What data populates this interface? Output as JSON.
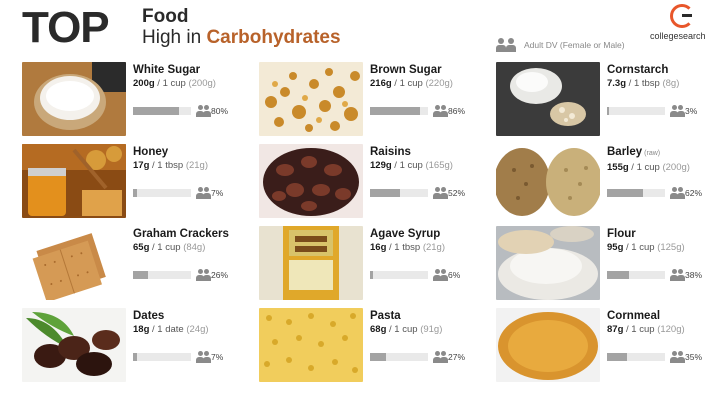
{
  "header": {
    "top": "TOP",
    "line1": "Food",
    "line2_prefix": "High in",
    "line2_highlight": "Carbohydrates",
    "accent_color": "#b8622a"
  },
  "logo": {
    "text": "collegesearch",
    "icon": "collegesearch-c-icon",
    "color": "#e8562a"
  },
  "legend": {
    "text": "Adult DV (Female or Male)",
    "icon": "people-icon"
  },
  "foods": [
    {
      "name": "White Sugar",
      "tag": "",
      "amount": "200g",
      "serving": "1 cup",
      "alt": "(200g)",
      "pct_label": "80%",
      "pct": 80,
      "image": "white-sugar-photo"
    },
    {
      "name": "Brown Sugar",
      "tag": "",
      "amount": "216g",
      "serving": "1 cup",
      "alt": "(220g)",
      "pct_label": "86%",
      "pct": 86,
      "image": "brown-sugar-photo"
    },
    {
      "name": "Cornstarch",
      "tag": "",
      "amount": "7.3g",
      "serving": "1 tbsp",
      "alt": "(8g)",
      "pct_label": "3%",
      "pct": 3,
      "image": "cornstarch-photo"
    },
    {
      "name": "Honey",
      "tag": "",
      "amount": "17g",
      "serving": "1 tbsp",
      "alt": "(21g)",
      "pct_label": "7%",
      "pct": 7,
      "image": "honey-photo"
    },
    {
      "name": "Raisins",
      "tag": "",
      "amount": "129g",
      "serving": "1 cup",
      "alt": "(165g)",
      "pct_label": "52%",
      "pct": 52,
      "image": "raisins-photo"
    },
    {
      "name": "Barley",
      "tag": "(raw)",
      "amount": "155g",
      "serving": "1 cup",
      "alt": "(200g)",
      "pct_label": "62%",
      "pct": 62,
      "image": "barley-photo"
    },
    {
      "name": "Graham Crackers",
      "tag": "",
      "amount": "65g",
      "serving": "1 cup",
      "alt": "(84g)",
      "pct_label": "26%",
      "pct": 26,
      "image": "graham-crackers-photo"
    },
    {
      "name": "Agave Syrup",
      "tag": "",
      "amount": "16g",
      "serving": "1 tbsp",
      "alt": "(21g)",
      "pct_label": "6%",
      "pct": 6,
      "image": "agave-syrup-photo"
    },
    {
      "name": "Flour",
      "tag": "",
      "amount": "95g",
      "serving": "1 cup",
      "alt": "(125g)",
      "pct_label": "38%",
      "pct": 38,
      "image": "flour-photo"
    },
    {
      "name": "Dates",
      "tag": "",
      "amount": "18g",
      "serving": "1 date",
      "alt": "(24g)",
      "pct_label": "7%",
      "pct": 7,
      "image": "dates-photo"
    },
    {
      "name": "Pasta",
      "tag": "",
      "amount": "68g",
      "serving": "1 cup",
      "alt": "(91g)",
      "pct_label": "27%",
      "pct": 27,
      "image": "pasta-photo"
    },
    {
      "name": "Cornmeal",
      "tag": "",
      "amount": "87g",
      "serving": "1 cup",
      "alt": "(120g)",
      "pct_label": "35%",
      "pct": 35,
      "image": "cornmeal-photo"
    }
  ]
}
